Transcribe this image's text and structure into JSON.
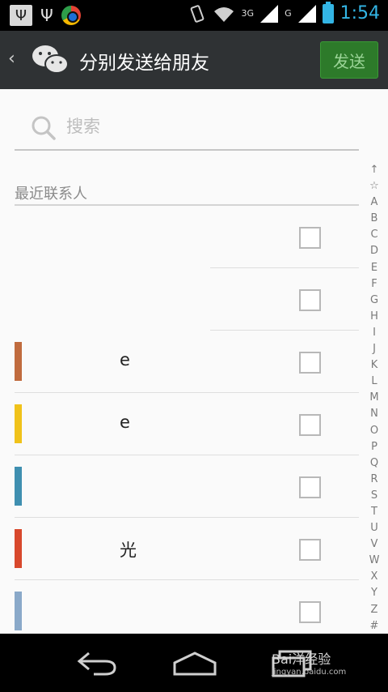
{
  "status_bar": {
    "network_3g": "3G",
    "network_g": "G",
    "time": "1:54",
    "icons": [
      "usb-debug-icon",
      "usb-icon",
      "chrome-icon",
      "vibrate-icon",
      "wifi-icon",
      "signal-icon",
      "battery-icon"
    ]
  },
  "header": {
    "back_symbol": "‹",
    "title": "分别发送给朋友",
    "send_label": "发送"
  },
  "search": {
    "placeholder": "搜索"
  },
  "section": {
    "label": "最近联系人"
  },
  "contacts": [
    {
      "name": "",
      "checked": false,
      "has_avatar": false
    },
    {
      "name": "",
      "checked": false,
      "has_avatar": false
    },
    {
      "name": "е",
      "checked": false,
      "has_avatar": true,
      "avatar_color": "#c06b3e"
    },
    {
      "name": "е",
      "checked": false,
      "has_avatar": true,
      "avatar_color": "#f0c21a"
    },
    {
      "name": "",
      "checked": false,
      "has_avatar": true,
      "avatar_color": "#3f8fb0"
    },
    {
      "name": "光",
      "checked": false,
      "has_avatar": true,
      "avatar_color": "#d8482c"
    },
    {
      "name": "",
      "checked": false,
      "has_avatar": true,
      "avatar_color": "#8aa9c9"
    }
  ],
  "index_letters": [
    "↑",
    "☆",
    "A",
    "B",
    "C",
    "D",
    "E",
    "F",
    "G",
    "H",
    "I",
    "J",
    "K",
    "L",
    "M",
    "N",
    "O",
    "P",
    "Q",
    "R",
    "S",
    "T",
    "U",
    "V",
    "W",
    "X",
    "Y",
    "Z",
    "#"
  ],
  "watermark": {
    "brand": "Bai洋经验",
    "url": "jingyan.baidu.com"
  }
}
